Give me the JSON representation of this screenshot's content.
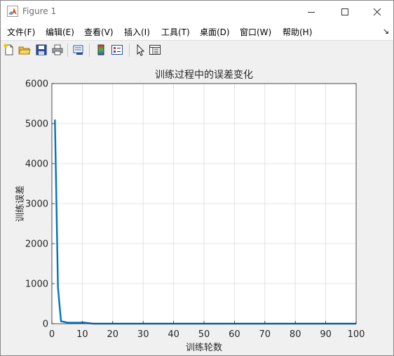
{
  "window": {
    "title": "Figure 1"
  },
  "menu": {
    "items": [
      {
        "label": "文件(F)"
      },
      {
        "label": "编辑(E)"
      },
      {
        "label": "查看(V)"
      },
      {
        "label": "插入(I)"
      },
      {
        "label": "工具(T)"
      },
      {
        "label": "桌面(D)"
      },
      {
        "label": "窗口(W)"
      },
      {
        "label": "帮助(H)"
      }
    ],
    "overflow_icon": "curved-arrow-icon"
  },
  "toolbar": {
    "tools": [
      "new-figure-icon",
      "open-file-icon",
      "save-icon",
      "print-icon",
      "link-plot-icon",
      "colorbar-icon",
      "legend-icon",
      "pointer-icon",
      "property-inspector-icon"
    ]
  },
  "chart_data": {
    "type": "line",
    "title": "训练过程中的误差变化",
    "xlabel": "训练轮数",
    "ylabel": "训练误差",
    "xlim": [
      0,
      100
    ],
    "ylim": [
      0,
      6000
    ],
    "xticks": [
      "0",
      "10",
      "20",
      "30",
      "40",
      "50",
      "60",
      "70",
      "80",
      "90",
      "100"
    ],
    "yticks": [
      "0",
      "1000",
      "2000",
      "3000",
      "4000",
      "5000",
      "6000"
    ],
    "grid": true,
    "line_color": "#0072bd",
    "series": [
      {
        "x": [
          1,
          2,
          3,
          4,
          5,
          6,
          7,
          8,
          9,
          10,
          11,
          12,
          13,
          14,
          15,
          20,
          30,
          40,
          50,
          60,
          70,
          80,
          90,
          100
        ],
        "values": [
          5100,
          900,
          60,
          45,
          30,
          25,
          25,
          25,
          25,
          30,
          25,
          15,
          5,
          2,
          1,
          1,
          1,
          1,
          1,
          1,
          1,
          1,
          1,
          1
        ]
      }
    ]
  }
}
